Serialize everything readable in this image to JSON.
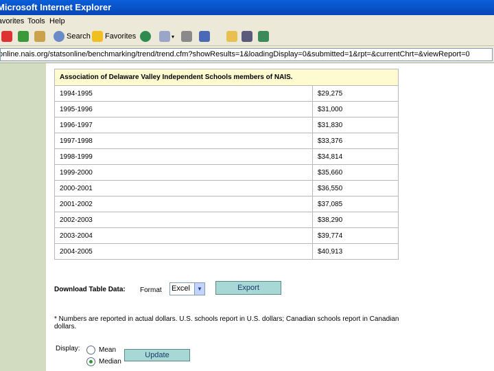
{
  "window": {
    "title": "Microsoft Internet Explorer"
  },
  "menu": {
    "items": [
      "Favorites",
      "Tools",
      "Help"
    ]
  },
  "toolbar": {
    "search_label": "Search",
    "favorites_label": "Favorites"
  },
  "address": {
    "url": "online.nais.org/statsonline/benchmarking/trend/trend.cfm?showResults=1&loadingDisplay=0&submitted=1&rpt=&currentChrt=&viewReport=0"
  },
  "table": {
    "header": "Association of Delaware Valley Independent Schools members of NAIS.",
    "rows": [
      {
        "year": "1994-1995",
        "value": "$29,275"
      },
      {
        "year": "1995-1996",
        "value": "$31,000"
      },
      {
        "year": "1996-1997",
        "value": "$31,830"
      },
      {
        "year": "1997-1998",
        "value": "$33,376"
      },
      {
        "year": "1998-1999",
        "value": "$34,814"
      },
      {
        "year": "1999-2000",
        "value": "$35,660"
      },
      {
        "year": "2000-2001",
        "value": "$36,550"
      },
      {
        "year": "2001-2002",
        "value": "$37,085"
      },
      {
        "year": "2002-2003",
        "value": "$38,290"
      },
      {
        "year": "2003-2004",
        "value": "$39,774"
      },
      {
        "year": "2004-2005",
        "value": "$40,913"
      }
    ]
  },
  "download": {
    "label": "Download Table Data:",
    "format_label": "Format",
    "format_value": "Excel",
    "export_label": "Export"
  },
  "note": "* Numbers are reported in actual dollars. U.S. schools report in U.S. dollars; Canadian schools report in Canadian dollars.",
  "display": {
    "label": "Display:",
    "options": [
      {
        "label": "Mean",
        "checked": false
      },
      {
        "label": "Median",
        "checked": true
      }
    ],
    "update_label": "Update"
  }
}
